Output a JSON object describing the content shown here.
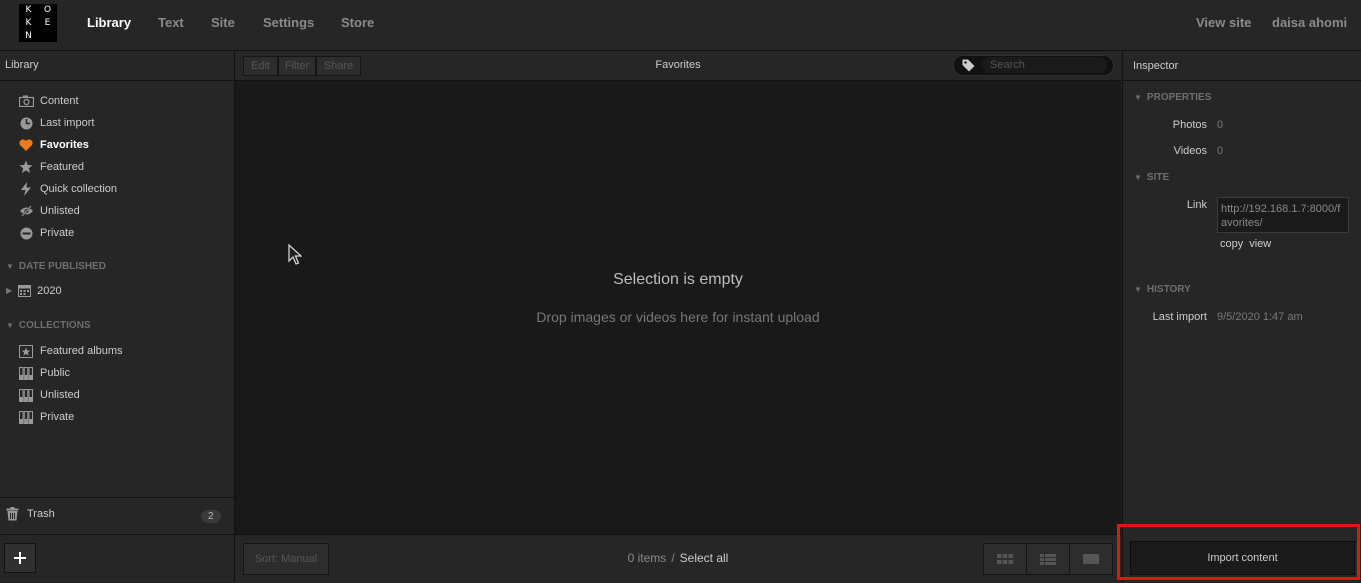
{
  "topnav": {
    "logo_letters": [
      "K",
      "O",
      "K",
      "E",
      "N"
    ],
    "items": [
      "Library",
      "Text",
      "Site",
      "Settings",
      "Store"
    ],
    "view_site": "View site",
    "user": "daisa ahomi"
  },
  "sidebar": {
    "title": "Library",
    "items": [
      {
        "label": "Content",
        "icon": "camera-icon"
      },
      {
        "label": "Last import",
        "icon": "clock-icon"
      },
      {
        "label": "Favorites",
        "icon": "heart-icon"
      },
      {
        "label": "Featured",
        "icon": "star-icon"
      },
      {
        "label": "Quick collection",
        "icon": "lightning-icon"
      },
      {
        "label": "Unlisted",
        "icon": "eye-slash-icon"
      },
      {
        "label": "Private",
        "icon": "lock-circle-icon"
      }
    ],
    "date_published": "DATE PUBLISHED",
    "year": "2020",
    "collections": "COLLECTIONS",
    "collection_items": [
      "Featured albums",
      "Public",
      "Unlisted",
      "Private"
    ],
    "trash": "Trash",
    "trash_count": "2",
    "accent_color": "#f07a1a"
  },
  "main": {
    "toolbar": {
      "edit": "Edit",
      "filter": "Filter",
      "share": "Share"
    },
    "title": "Favorites",
    "search_placeholder": "Search",
    "empty_title": "Selection is empty",
    "empty_subtitle": "Drop images or videos here for instant upload",
    "sort": "Sort: Manual",
    "items_count": "0 items",
    "separator": "/",
    "select_all": "Select all"
  },
  "inspector": {
    "title": "Inspector",
    "properties": "PROPERTIES",
    "photos_label": "Photos",
    "photos_value": "0",
    "videos_label": "Videos",
    "videos_value": "0",
    "site": "SITE",
    "link_label": "Link",
    "link_value": "http://192.168.1.7:8000/favorites/",
    "copy": "copy",
    "view": "view",
    "history": "HISTORY",
    "last_import_label": "Last import",
    "last_import_value": "9/5/2020 1:47 am",
    "import_button": "Import content",
    "highlight_color": "#e31414"
  }
}
